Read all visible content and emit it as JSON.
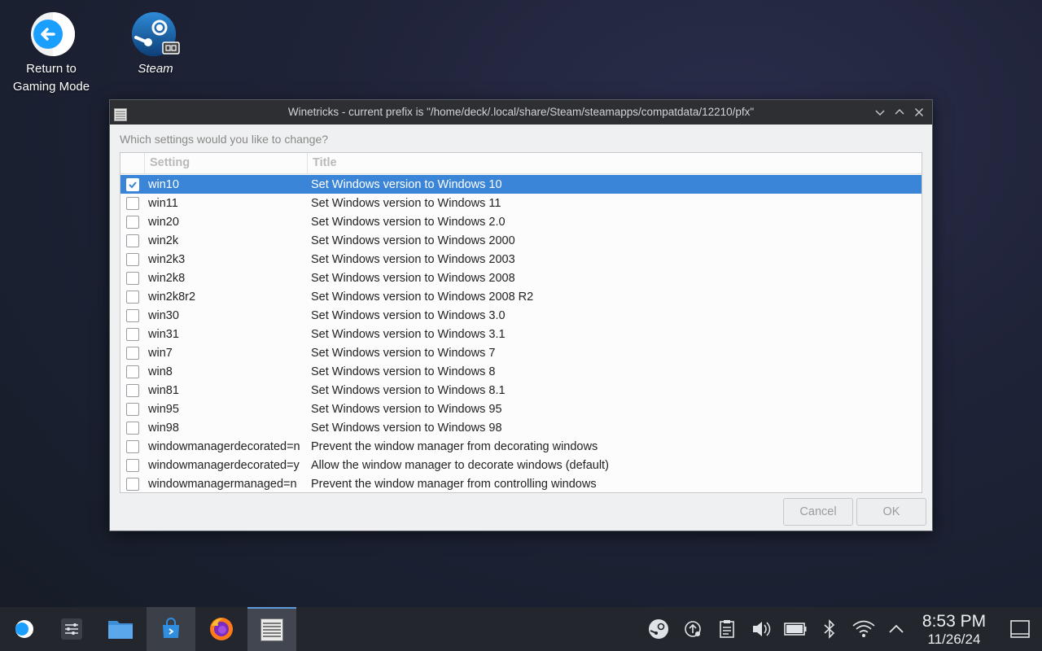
{
  "desktop": {
    "icons": [
      {
        "label_line1": "Return to",
        "label_line2": "Gaming Mode",
        "icon": "return-arrow-icon"
      },
      {
        "label_line1": "Steam",
        "icon": "steam-icon"
      }
    ]
  },
  "window": {
    "title": "Winetricks - current prefix is \"/home/deck/.local/share/Steam/steamapps/compatdata/12210/pfx\"",
    "prompt": "Which settings would you like to change?",
    "columns": [
      "Setting",
      "Title"
    ],
    "rows": [
      {
        "setting": "win10",
        "title": "Set Windows version to Windows 10",
        "checked": true,
        "selected": true
      },
      {
        "setting": "win11",
        "title": "Set Windows version to Windows 11",
        "checked": false
      },
      {
        "setting": "win20",
        "title": "Set Windows version to Windows 2.0",
        "checked": false
      },
      {
        "setting": "win2k",
        "title": "Set Windows version to Windows 2000",
        "checked": false
      },
      {
        "setting": "win2k3",
        "title": "Set Windows version to Windows 2003",
        "checked": false
      },
      {
        "setting": "win2k8",
        "title": "Set Windows version to Windows 2008",
        "checked": false
      },
      {
        "setting": "win2k8r2",
        "title": "Set Windows version to Windows 2008 R2",
        "checked": false
      },
      {
        "setting": "win30",
        "title": "Set Windows version to Windows 3.0",
        "checked": false
      },
      {
        "setting": "win31",
        "title": "Set Windows version to Windows 3.1",
        "checked": false
      },
      {
        "setting": "win7",
        "title": "Set Windows version to Windows 7",
        "checked": false
      },
      {
        "setting": "win8",
        "title": "Set Windows version to Windows 8",
        "checked": false
      },
      {
        "setting": "win81",
        "title": "Set Windows version to Windows 8.1",
        "checked": false
      },
      {
        "setting": "win95",
        "title": "Set Windows version to Windows 95",
        "checked": false
      },
      {
        "setting": "win98",
        "title": "Set Windows version to Windows 98",
        "checked": false
      },
      {
        "setting": "windowmanagerdecorated=n",
        "title": "Prevent the window manager from decorating windows",
        "checked": false
      },
      {
        "setting": "windowmanagerdecorated=y",
        "title": "Allow the window manager to decorate windows (default)",
        "checked": false
      },
      {
        "setting": "windowmanagermanaged=n",
        "title": "Prevent the window manager from controlling windows",
        "checked": false
      }
    ],
    "buttons": {
      "cancel": "Cancel",
      "ok": "OK"
    }
  },
  "taskbar": {
    "time": "8:53 PM",
    "date": "11/26/24",
    "accent": "#3b85d8"
  }
}
